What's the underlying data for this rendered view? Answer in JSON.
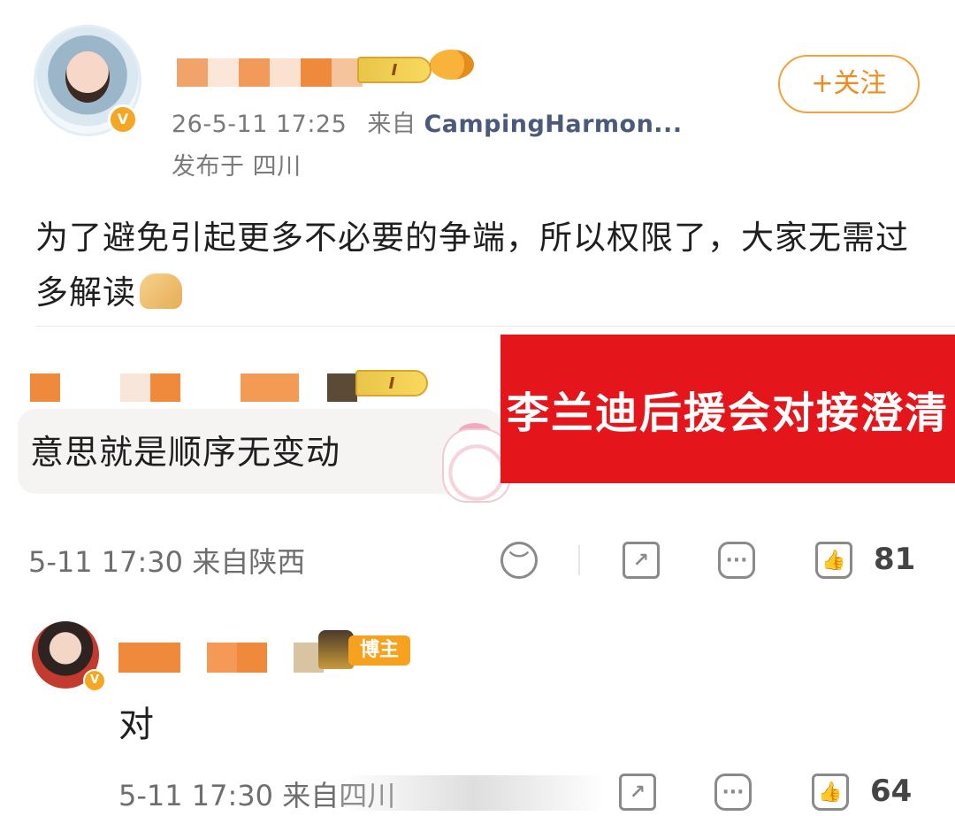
{
  "post": {
    "timestamp": "26-5-11 17:25",
    "source_prefix": "来自 ",
    "source": "CampingHarmon...",
    "location": "发布于 四川",
    "follow_label": "+关注",
    "level_badge": "I",
    "body": "为了避免引起更多不必要的争端，所以权限了，大家无需过多解读"
  },
  "banner": {
    "text": "李兰迪后援会对接澄清"
  },
  "comment": {
    "level_badge": "I",
    "text": "意思就是顺序无变动",
    "timestamp": "5-11 17:30 来自陕西",
    "like_count": "81"
  },
  "reply": {
    "role_badge": "博主",
    "text": "对",
    "timestamp": "5-11 17:30 来自四川",
    "like_count": "64"
  },
  "colors": {
    "accent": "#f28a1e",
    "banner_red": "#e4151b",
    "verified": "#f5a623"
  }
}
